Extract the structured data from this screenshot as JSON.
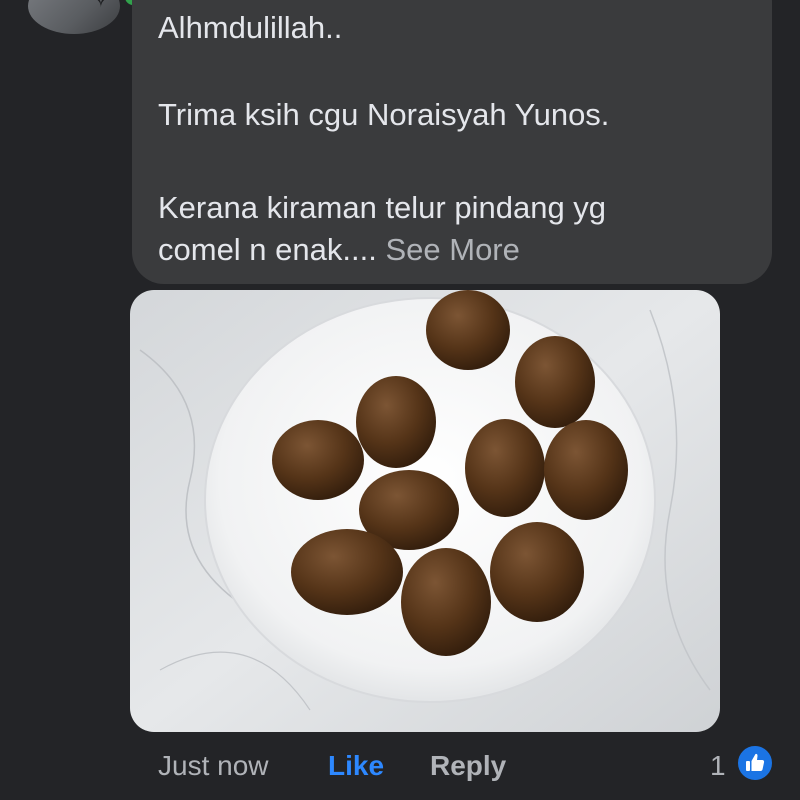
{
  "comment": {
    "text_lines": [
      "Alhmdulillah..",
      "Trima ksih cgu Noraisyah Yunos.",
      "Kerana kiraman telur pindang yg",
      "comel n enak...."
    ],
    "see_more_label": "See More"
  },
  "actions": {
    "timestamp": "Just now",
    "like_label": "Like",
    "reply_label": "Reply"
  },
  "reactions": {
    "count": "1",
    "icon": "thumbs-up-icon"
  },
  "colors": {
    "background": "#232427",
    "bubble": "#3a3b3d",
    "text": "#e4e6eb",
    "muted": "#b0b3b8",
    "accent": "#2d88ff",
    "online": "#31a24c"
  }
}
